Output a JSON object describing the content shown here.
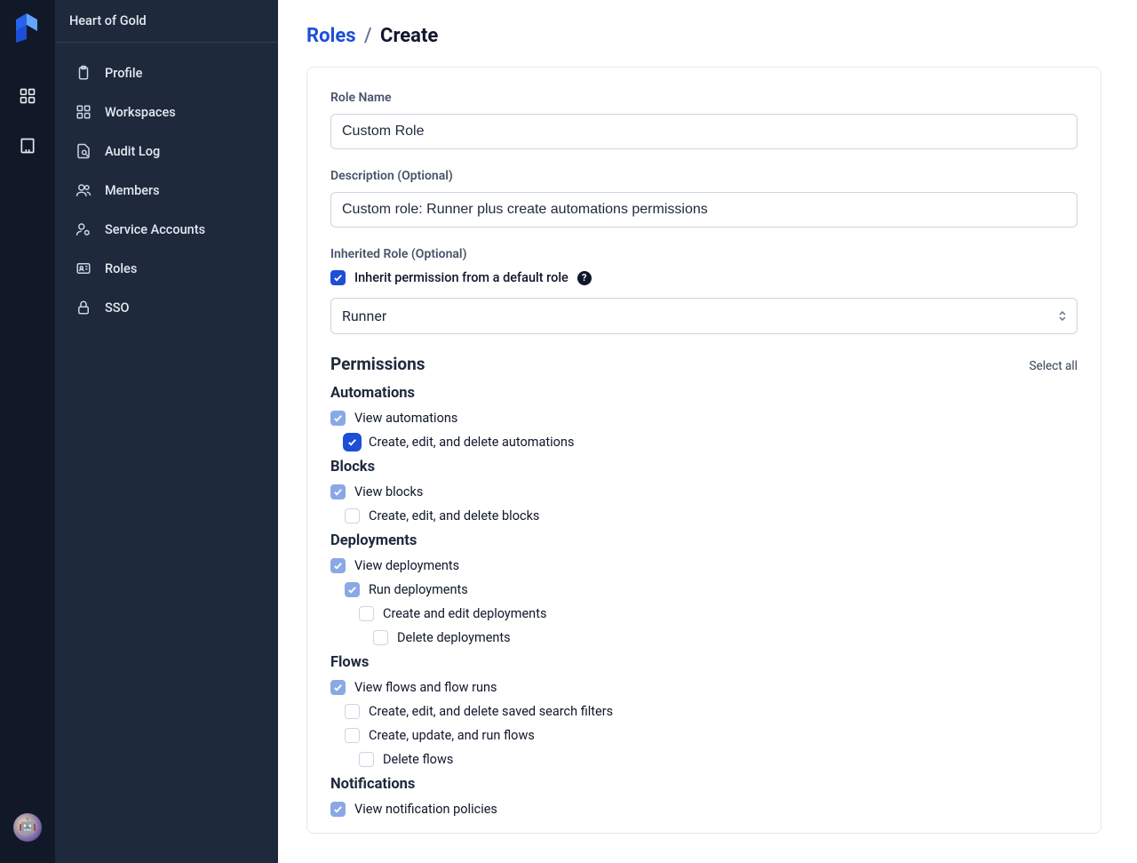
{
  "workspace_name": "Heart of Gold",
  "sidebar": {
    "items": [
      {
        "label": "Profile",
        "icon": "clipboard"
      },
      {
        "label": "Workspaces",
        "icon": "grid"
      },
      {
        "label": "Audit Log",
        "icon": "audit"
      },
      {
        "label": "Members",
        "icon": "users"
      },
      {
        "label": "Service Accounts",
        "icon": "gear-user"
      },
      {
        "label": "Roles",
        "icon": "id-card"
      },
      {
        "label": "SSO",
        "icon": "lock"
      }
    ]
  },
  "breadcrumb": {
    "parent": "Roles",
    "current": "Create"
  },
  "form": {
    "role_name_label": "Role Name",
    "role_name_value": "Custom Role",
    "description_label": "Description (Optional)",
    "description_value": "Custom role: Runner plus create automations permissions",
    "inherited_label": "Inherited Role (Optional)",
    "inherit_checkbox_label": "Inherit permission from a default role",
    "inherit_checked": true,
    "inherit_select_value": "Runner"
  },
  "permissions": {
    "title": "Permissions",
    "select_all_label": "Select all",
    "groups": [
      {
        "title": "Automations",
        "items": [
          {
            "label": "View automations",
            "checked": true,
            "disabled": true,
            "indent": 0
          },
          {
            "label": "Create, edit, and delete automations",
            "checked": true,
            "disabled": false,
            "focus": true,
            "indent": 1
          }
        ]
      },
      {
        "title": "Blocks",
        "items": [
          {
            "label": "View blocks",
            "checked": true,
            "disabled": true,
            "indent": 0
          },
          {
            "label": "Create, edit, and delete blocks",
            "checked": false,
            "disabled": false,
            "indent": 1
          }
        ]
      },
      {
        "title": "Deployments",
        "items": [
          {
            "label": "View deployments",
            "checked": true,
            "disabled": true,
            "indent": 0
          },
          {
            "label": "Run deployments",
            "checked": true,
            "disabled": true,
            "indent": 1
          },
          {
            "label": "Create and edit deployments",
            "checked": false,
            "disabled": false,
            "indent": 2
          },
          {
            "label": "Delete deployments",
            "checked": false,
            "disabled": false,
            "indent": 3
          }
        ]
      },
      {
        "title": "Flows",
        "items": [
          {
            "label": "View flows and flow runs",
            "checked": true,
            "disabled": true,
            "indent": 0
          },
          {
            "label": "Create, edit, and delete saved search filters",
            "checked": false,
            "disabled": false,
            "indent": 1
          },
          {
            "label": "Create, update, and run flows",
            "checked": false,
            "disabled": false,
            "indent": 1
          },
          {
            "label": "Delete flows",
            "checked": false,
            "disabled": false,
            "indent": 2
          }
        ]
      },
      {
        "title": "Notifications",
        "items": [
          {
            "label": "View notification policies",
            "checked": true,
            "disabled": true,
            "indent": 0
          }
        ]
      }
    ]
  }
}
